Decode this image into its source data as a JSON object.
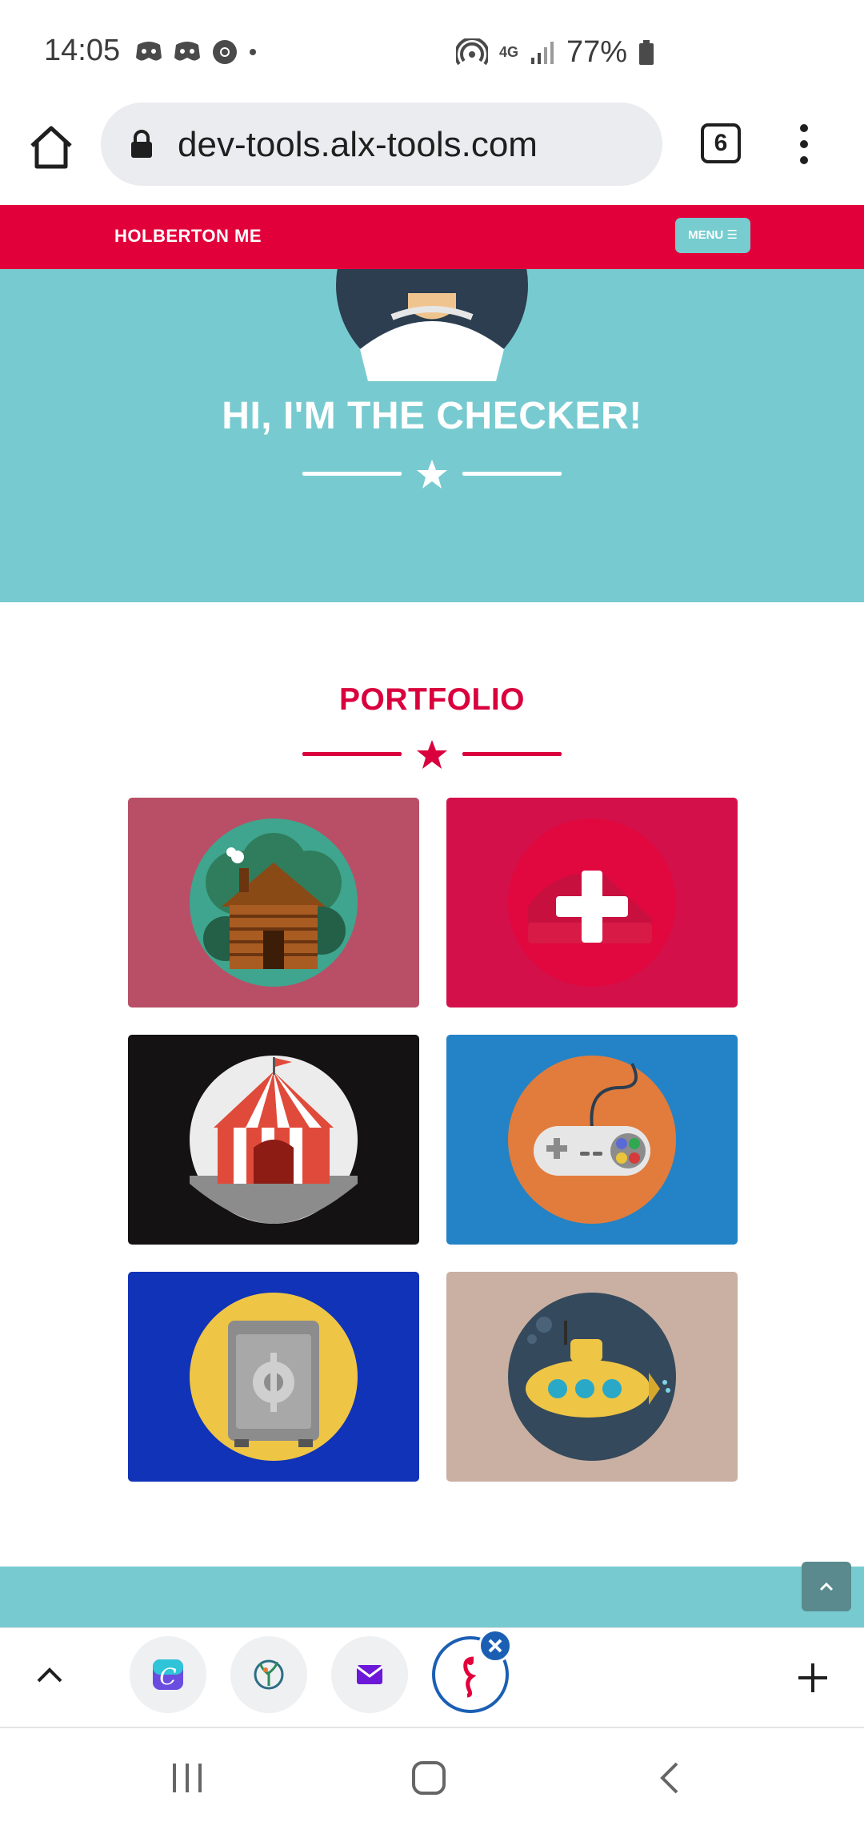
{
  "status_bar": {
    "time": "14:05",
    "network": "4G",
    "battery": "77%"
  },
  "browser": {
    "url": "dev-tools.alx-tools.com",
    "tab_count": "6"
  },
  "site_nav": {
    "brand": "HOLBERTON ME",
    "menu_label": "MENU"
  },
  "hero": {
    "title": "HI, I'M THE CHECKER!"
  },
  "portfolio": {
    "title": "PORTFOLIO",
    "items": [
      {
        "icon": "log-cabin-icon",
        "bg": "#b84f66",
        "circle": "#3fa58e"
      },
      {
        "icon": "plus-cake-icon",
        "bg": "#d4104a",
        "circle": "#e0083f"
      },
      {
        "icon": "circus-tent-icon",
        "bg": "#141212",
        "circle": "#ececec"
      },
      {
        "icon": "game-controller-icon",
        "bg": "#2383c6",
        "circle": "#e27c3c"
      },
      {
        "icon": "safe-icon",
        "bg": "#1033b8",
        "circle": "#eec545"
      },
      {
        "icon": "submarine-icon",
        "bg": "#c9b0a3",
        "circle": "#34495b"
      }
    ]
  },
  "colors": {
    "accent_red": "#e2003b",
    "teal": "#77cbd0"
  }
}
